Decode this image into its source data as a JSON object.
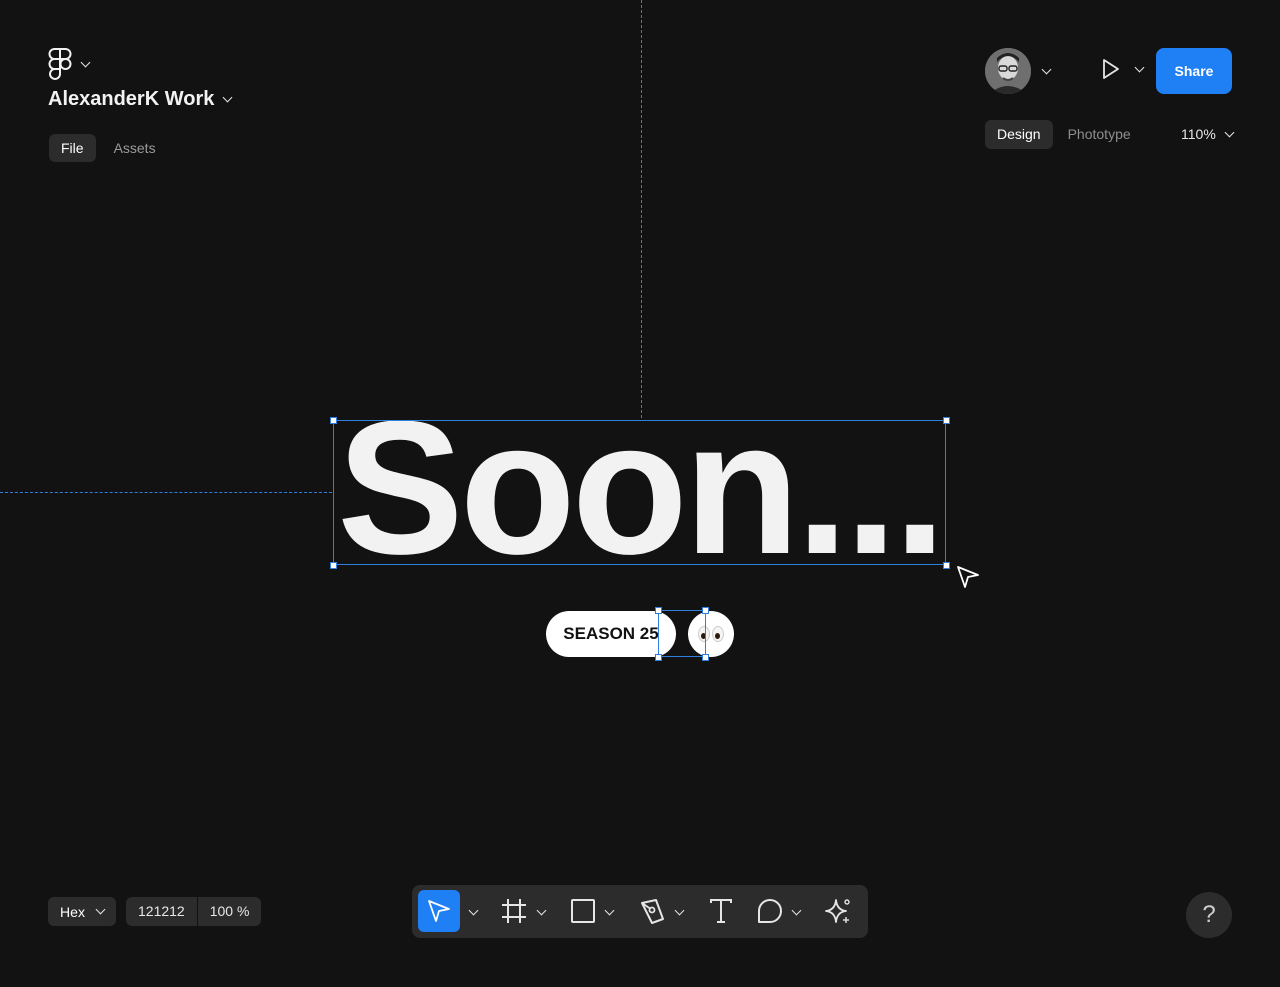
{
  "app": {
    "file_name": "AlexanderK Work",
    "tabs": [
      {
        "label": "File",
        "active": true
      },
      {
        "label": "Assets",
        "active": false
      }
    ]
  },
  "header": {
    "share_label": "Share",
    "mode_tabs": [
      {
        "label": "Design",
        "active": true
      },
      {
        "label": "Phototype",
        "active": false
      }
    ],
    "zoom": "110%"
  },
  "canvas": {
    "main_text": "Soon...",
    "pill_text": "SEASON 25",
    "emoji_name": "eyes-emoji"
  },
  "color_controls": {
    "format": "Hex",
    "value": "121212",
    "opacity": "100 %"
  },
  "toolbar": {
    "tools": [
      "move-tool",
      "frame-tool",
      "shape-tool",
      "pen-tool",
      "text-tool",
      "comment-tool",
      "ai-tool"
    ],
    "active_tool": "move-tool"
  },
  "help_label": "?",
  "colors": {
    "background": "#121212",
    "accent": "#1f7ff5",
    "selection": "#2f7fe0",
    "panel": "#2c2c2c"
  }
}
